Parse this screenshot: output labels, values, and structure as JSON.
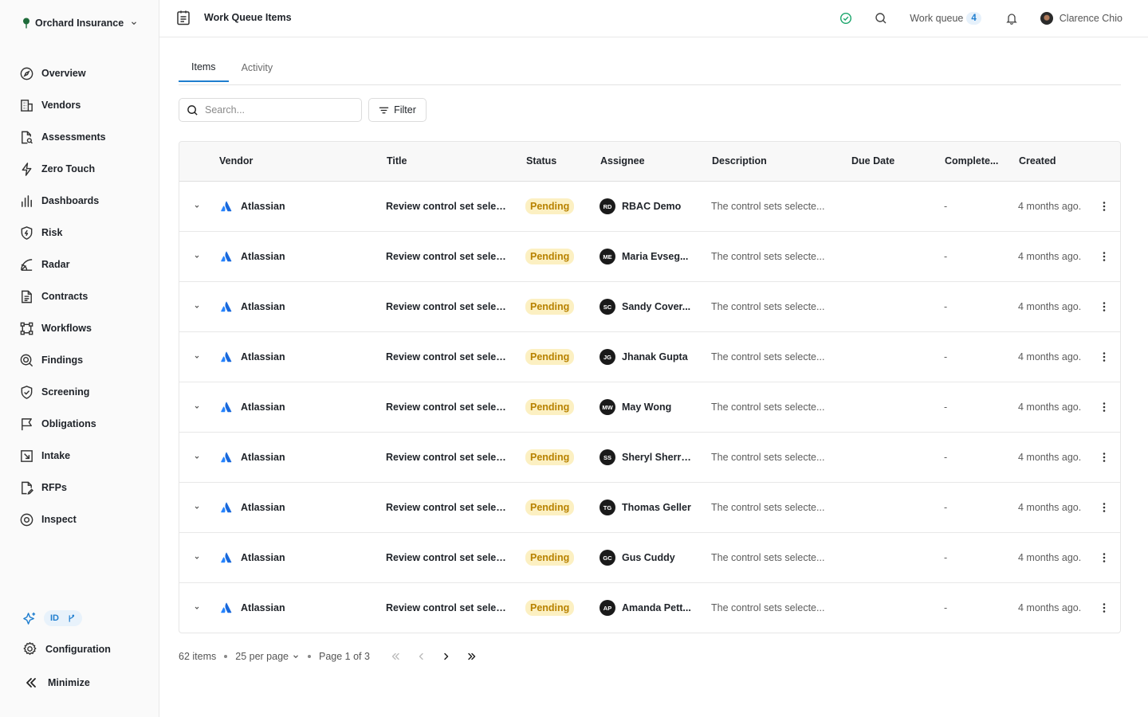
{
  "sidebar": {
    "org_name": "Orchard Insurance",
    "items": [
      {
        "label": "Overview",
        "icon": "compass-icon"
      },
      {
        "label": "Vendors",
        "icon": "building-icon"
      },
      {
        "label": "Assessments",
        "icon": "document-search-icon"
      },
      {
        "label": "Zero Touch",
        "icon": "lightning-icon"
      },
      {
        "label": "Dashboards",
        "icon": "bar-chart-icon"
      },
      {
        "label": "Risk",
        "icon": "shield-icon"
      },
      {
        "label": "Radar",
        "icon": "radar-icon"
      },
      {
        "label": "Contracts",
        "icon": "file-text-icon"
      },
      {
        "label": "Workflows",
        "icon": "workflow-icon"
      },
      {
        "label": "Findings",
        "icon": "magnifier-icon"
      },
      {
        "label": "Screening",
        "icon": "shield-check-icon"
      },
      {
        "label": "Obligations",
        "icon": "flag-icon"
      },
      {
        "label": "Intake",
        "icon": "inbox-arrow-icon"
      },
      {
        "label": "RFPs",
        "icon": "file-edit-icon"
      },
      {
        "label": "Inspect",
        "icon": "eye-icon"
      }
    ],
    "badge_label": "ID",
    "configuration_label": "Configuration",
    "minimize_label": "Minimize"
  },
  "topbar": {
    "title": "Work Queue Items",
    "work_queue_label": "Work queue",
    "work_queue_count": "4",
    "user_name": "Clarence Chio"
  },
  "tabs": [
    {
      "label": "Items",
      "active": true
    },
    {
      "label": "Activity",
      "active": false
    }
  ],
  "search": {
    "placeholder": "Search..."
  },
  "filter_label": "Filter",
  "table": {
    "columns": [
      "Vendor",
      "Title",
      "Status",
      "Assignee",
      "Description",
      "Due Date",
      "Complete...",
      "Created"
    ],
    "rows": [
      {
        "vendor": "Atlassian",
        "title": "Review control set selec...",
        "status": "Pending",
        "initials": "RD",
        "assignee": "RBAC Demo",
        "description": "The control sets selecte...",
        "due_date": "",
        "completed": "-",
        "created": "4 months ago."
      },
      {
        "vendor": "Atlassian",
        "title": "Review control set selec...",
        "status": "Pending",
        "initials": "ME",
        "assignee": "Maria Evseg...",
        "description": "The control sets selecte...",
        "due_date": "",
        "completed": "-",
        "created": "4 months ago."
      },
      {
        "vendor": "Atlassian",
        "title": "Review control set selec...",
        "status": "Pending",
        "initials": "SC",
        "assignee": "Sandy Cover...",
        "description": "The control sets selecte...",
        "due_date": "",
        "completed": "-",
        "created": "4 months ago."
      },
      {
        "vendor": "Atlassian",
        "title": "Review control set selec...",
        "status": "Pending",
        "initials": "JG",
        "assignee": "Jhanak Gupta",
        "description": "The control sets selecte...",
        "due_date": "",
        "completed": "-",
        "created": "4 months ago."
      },
      {
        "vendor": "Atlassian",
        "title": "Review control set selec...",
        "status": "Pending",
        "initials": "MW",
        "assignee": "May Wong",
        "description": "The control sets selecte...",
        "due_date": "",
        "completed": "-",
        "created": "4 months ago."
      },
      {
        "vendor": "Atlassian",
        "title": "Review control set selec...",
        "status": "Pending",
        "initials": "SS",
        "assignee": "Sheryl Sherrick",
        "description": "The control sets selecte...",
        "due_date": "",
        "completed": "-",
        "created": "4 months ago."
      },
      {
        "vendor": "Atlassian",
        "title": "Review control set selec...",
        "status": "Pending",
        "initials": "TG",
        "assignee": "Thomas Geller",
        "description": "The control sets selecte...",
        "due_date": "",
        "completed": "-",
        "created": "4 months ago."
      },
      {
        "vendor": "Atlassian",
        "title": "Review control set selec...",
        "status": "Pending",
        "initials": "GC",
        "assignee": "Gus Cuddy",
        "description": "The control sets selecte...",
        "due_date": "",
        "completed": "-",
        "created": "4 months ago."
      },
      {
        "vendor": "Atlassian",
        "title": "Review control set selec...",
        "status": "Pending",
        "initials": "AP",
        "assignee": "Amanda Pett...",
        "description": "The control sets selecte...",
        "due_date": "",
        "completed": "-",
        "created": "4 months ago."
      }
    ]
  },
  "pagination": {
    "items_count": "62 items",
    "per_page": "25 per page",
    "page_text": "Page 1 of 3"
  },
  "colors": {
    "accent": "#1f7ecf",
    "status_pending_bg": "#fcf0c2",
    "status_pending_text": "#b88200",
    "check_green": "#1aa56b",
    "atlassian_blue": "#2684ff"
  }
}
